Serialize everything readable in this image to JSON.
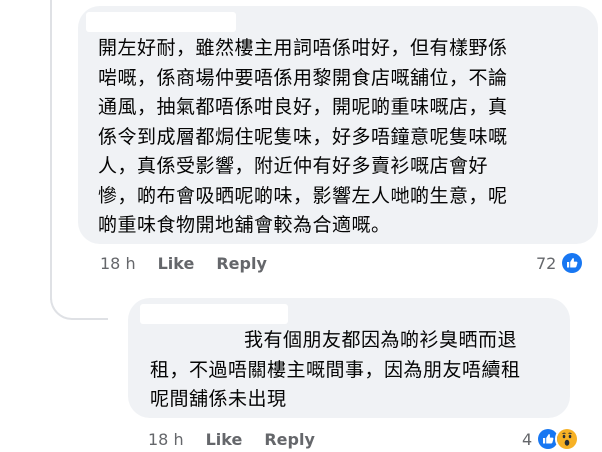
{
  "comments": [
    {
      "lines": [
        "開左好耐，雖然樓主用詞唔係咁好，但有樣野係",
        "啱嘅，係商場仲要唔係用黎開食店嘅舖位，不論",
        "通風，抽氣都唔係咁良好，開呢啲重味嘅店，真",
        "係令到成層都焗住呢隻味，好多唔鐘意呢隻味嘅",
        "人，真係受影響，附近仲有好多賣衫嘅店會好",
        "慘，啲布會吸晒呢啲味，影響左人哋啲生意，呢",
        "啲重味食物開地舖會較為合適嘅。"
      ],
      "time": "18 h",
      "like_label": "Like",
      "reply_label": "Reply",
      "reaction_count": "72",
      "reaction_icons": [
        "like-icon"
      ],
      "colors": {
        "like": "#1877f2"
      }
    },
    {
      "lines": [
        "我有個朋友都因為啲衫臭晒而退",
        "租，不過唔關樓主嘅間事，因為朋友唔續租",
        "呢間舖係未出現"
      ],
      "time": "18 h",
      "like_label": "Like",
      "reply_label": "Reply",
      "reaction_count": "4",
      "reaction_icons": [
        "like-icon",
        "wow-icon"
      ],
      "colors": {
        "like": "#1877f2",
        "wow": "#f7b125"
      }
    }
  ]
}
